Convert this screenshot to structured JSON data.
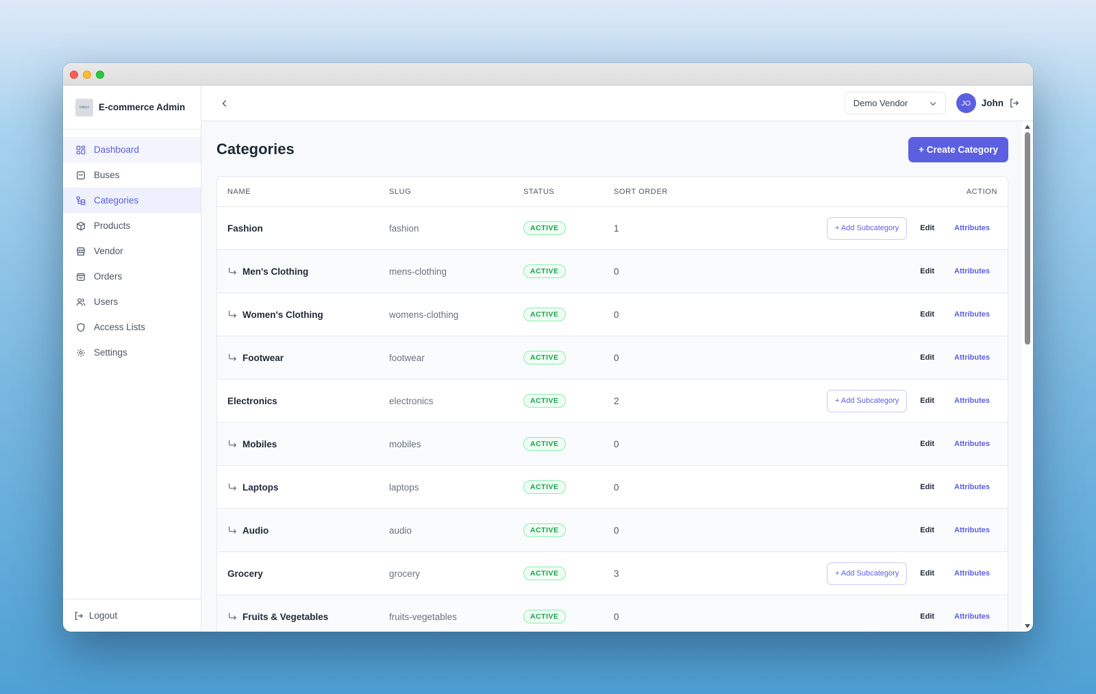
{
  "brand": {
    "name": "E-commerce Admin",
    "logo_text": "lollipol"
  },
  "sidebar": {
    "items": [
      {
        "label": "Dashboard",
        "icon": "dashboard-icon",
        "state": "active"
      },
      {
        "label": "Buses",
        "icon": "bus-icon"
      },
      {
        "label": "Categories",
        "icon": "categories-icon",
        "state": "selected"
      },
      {
        "label": "Products",
        "icon": "box-icon"
      },
      {
        "label": "Vendor",
        "icon": "store-icon"
      },
      {
        "label": "Orders",
        "icon": "bag-icon"
      },
      {
        "label": "Users",
        "icon": "users-icon"
      },
      {
        "label": "Access Lists",
        "icon": "shield-icon"
      },
      {
        "label": "Settings",
        "icon": "gear-icon"
      }
    ],
    "logout_label": "Logout"
  },
  "topbar": {
    "vendor_selected": "Demo Vendor",
    "user_initials": "JO",
    "user_name": "John"
  },
  "page": {
    "title": "Categories",
    "create_label": "+ Create Category"
  },
  "table": {
    "headers": {
      "name": "NAME",
      "slug": "SLUG",
      "status": "STATUS",
      "sort": "SORT ORDER",
      "action": "ACTION"
    },
    "add_sub_label": "+ Add Subcategory",
    "edit_label": "Edit",
    "attrs_label": "Attributes",
    "rows": [
      {
        "name": "Fashion",
        "slug": "fashion",
        "status": "ACTIVE",
        "sort": "1",
        "sub": false
      },
      {
        "name": "Men's Clothing",
        "slug": "mens-clothing",
        "status": "ACTIVE",
        "sort": "0",
        "sub": true
      },
      {
        "name": "Women's Clothing",
        "slug": "womens-clothing",
        "status": "ACTIVE",
        "sort": "0",
        "sub": true
      },
      {
        "name": "Footwear",
        "slug": "footwear",
        "status": "ACTIVE",
        "sort": "0",
        "sub": true
      },
      {
        "name": "Electronics",
        "slug": "electronics",
        "status": "ACTIVE",
        "sort": "2",
        "sub": false
      },
      {
        "name": "Mobiles",
        "slug": "mobiles",
        "status": "ACTIVE",
        "sort": "0",
        "sub": true
      },
      {
        "name": "Laptops",
        "slug": "laptops",
        "status": "ACTIVE",
        "sort": "0",
        "sub": true
      },
      {
        "name": "Audio",
        "slug": "audio",
        "status": "ACTIVE",
        "sort": "0",
        "sub": true
      },
      {
        "name": "Grocery",
        "slug": "grocery",
        "status": "ACTIVE",
        "sort": "3",
        "sub": false
      },
      {
        "name": "Fruits & Vegetables",
        "slug": "fruits-vegetables",
        "status": "ACTIVE",
        "sort": "0",
        "sub": true
      }
    ]
  },
  "colors": {
    "accent": "#5b5fe0",
    "active_green": "#16a34a"
  }
}
